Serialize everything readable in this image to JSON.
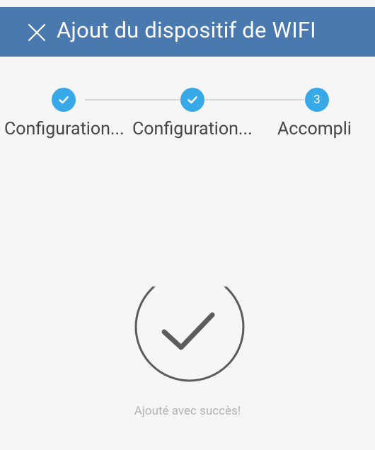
{
  "header": {
    "title": "Ajout du dispositif de WIFI",
    "close_icon": "close-icon",
    "background_color": "#4a79b0"
  },
  "stepper": {
    "accent_color": "#37a8e8",
    "steps": [
      {
        "label": "Configuration...",
        "state": "done",
        "icon": "check-icon"
      },
      {
        "label": "Configuration...",
        "state": "done",
        "icon": "check-icon"
      },
      {
        "label": "Accompli",
        "state": "current",
        "number": "3"
      }
    ]
  },
  "result": {
    "icon": "check-circle-icon",
    "message": "Ajouté avec succès!"
  }
}
